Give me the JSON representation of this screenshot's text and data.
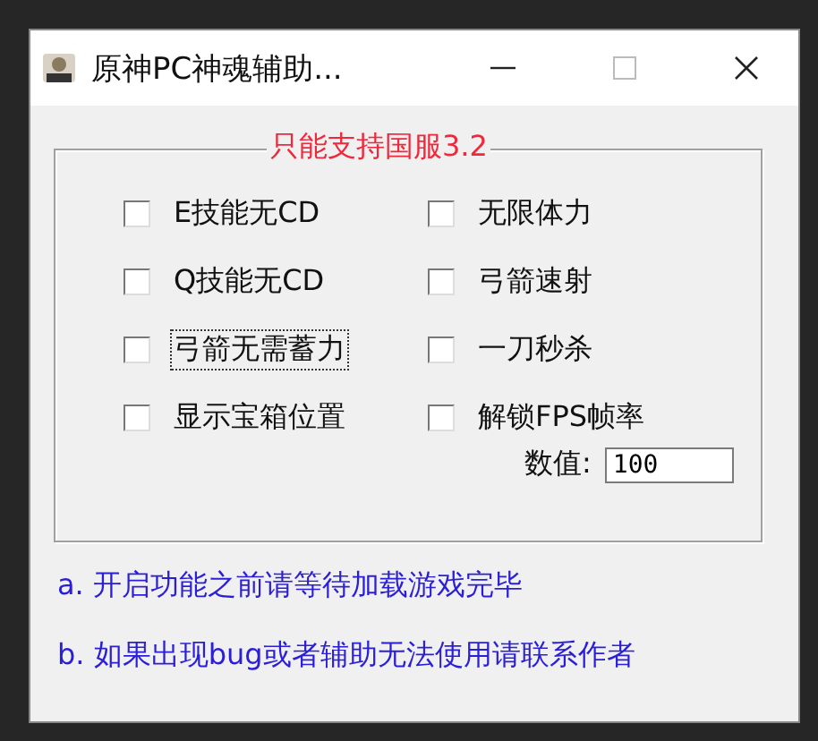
{
  "window": {
    "title": "原神PC神魂辅助..."
  },
  "group": {
    "legend": "只能支持国服3.2"
  },
  "options": [
    {
      "label": "E技能无CD",
      "checked": false,
      "focused": false
    },
    {
      "label": "无限体力",
      "checked": false,
      "focused": false
    },
    {
      "label": "Q技能无CD",
      "checked": false,
      "focused": false
    },
    {
      "label": "弓箭速射",
      "checked": false,
      "focused": false
    },
    {
      "label": "弓箭无需蓄力",
      "checked": false,
      "focused": true
    },
    {
      "label": "一刀秒杀",
      "checked": false,
      "focused": false
    },
    {
      "label": "显示宝箱位置",
      "checked": false,
      "focused": false
    },
    {
      "label": "解锁FPS帧率",
      "checked": false,
      "focused": false
    }
  ],
  "value_field": {
    "label": "数值:",
    "value": "100"
  },
  "notes": [
    "a. 开启功能之前请等待加载游戏完毕",
    "b. 如果出现bug或者辅助无法使用请联系作者"
  ]
}
